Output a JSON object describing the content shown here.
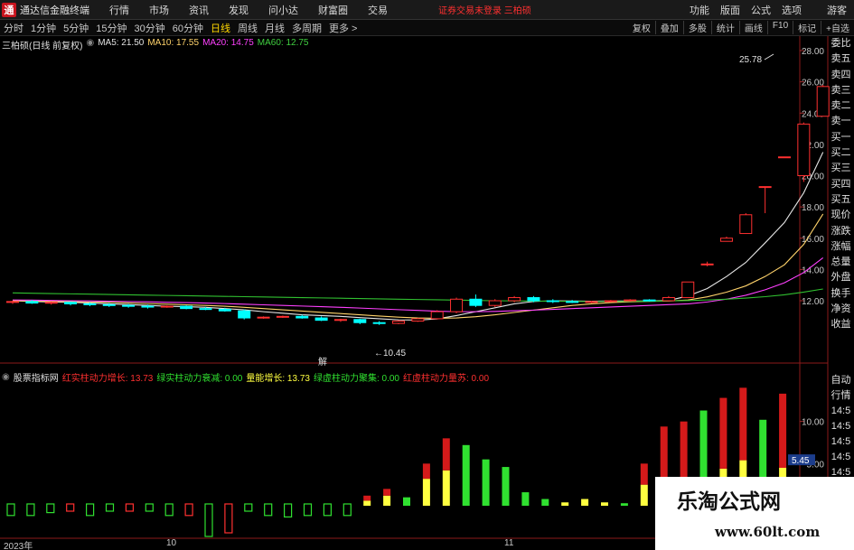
{
  "app": {
    "title": "通达信金融终端",
    "logo": "通",
    "menu": [
      "行情",
      "市场",
      "资讯",
      "发现",
      "问小达",
      "财富圈",
      "交易"
    ],
    "login_status": "证券交易未登录 三柏硕",
    "right_menu": [
      "功能",
      "版面",
      "公式",
      "选项"
    ],
    "guest": "游客"
  },
  "periods": {
    "items": [
      "分时",
      "1分钟",
      "5分钟",
      "15分钟",
      "30分钟",
      "60分钟",
      "日线",
      "周线",
      "月线",
      "多周期",
      "更多 >"
    ],
    "active": "日线"
  },
  "toolbar": [
    "复权",
    "叠加",
    "多股",
    "统计",
    "画线",
    "F10",
    "标记",
    "+自选"
  ],
  "stock": {
    "name": "三柏硕",
    "mode": "(日线 前复权)"
  },
  "ma": [
    {
      "label": "MA5: 21.50",
      "color": "#e0e0e0"
    },
    {
      "label": "MA10: 17.55",
      "color": "#ffd36b"
    },
    {
      "label": "MA20: 14.75",
      "color": "#ff40ff"
    },
    {
      "label": "MA60: 12.75",
      "color": "#40d040"
    }
  ],
  "right_panel": [
    "委比",
    "卖五",
    "卖四",
    "卖三",
    "卖二",
    "卖一",
    "买一",
    "买二",
    "买三",
    "买四",
    "买五",
    "现价",
    "涨跌",
    "涨幅",
    "总量",
    "外盘",
    "换手",
    "净资",
    "收益"
  ],
  "right_panel2": [
    "自动",
    "行情",
    "14:5",
    "14:5",
    "14:5",
    "14:5",
    "14:5",
    "14:5",
    "14:5",
    "14:5",
    "14:5",
    "14:5"
  ],
  "indicator": {
    "name": "股票指标网",
    "items": [
      {
        "label": "红实柱动力增长: 13.73",
        "color": "#ff3030"
      },
      {
        "label": "绿实柱动力衰减: 0.00",
        "color": "#30e030"
      },
      {
        "label": "量能增长: 13.73",
        "color": "#ffff40"
      },
      {
        "label": "绿虚柱动力聚集: 0.00",
        "color": "#30e030"
      },
      {
        "label": "红虚柱动力量苏: 0.00",
        "color": "#ff3030"
      }
    ],
    "ylabels": [
      "10.00",
      "5.00"
    ],
    "current": "5.45"
  },
  "annotations": {
    "high": "25.78",
    "low": "10.45",
    "event_mark": "解"
  },
  "time_axis": {
    "labels": [
      "2023年",
      "10",
      "11"
    ]
  },
  "watermark": {
    "text": "乐淘公式网",
    "url": "www.60lt.com"
  },
  "colors": {
    "up": "#ff3030",
    "down": "#00ffff",
    "up_fill": "#000000"
  },
  "chart_data": {
    "type": "candlestick",
    "ylim": [
      10.45,
      27.9
    ],
    "yticks": [
      12,
      14,
      16,
      18,
      20,
      22,
      24,
      26,
      28
    ],
    "ytick_labels": [
      "12.00",
      "14.00",
      "16.00",
      "18.00",
      "20.00",
      "22.00",
      "24.00",
      "26.00",
      "28.00"
    ],
    "candles": [
      [
        11.9,
        12.0,
        11.8,
        11.95
      ],
      [
        11.95,
        12.05,
        11.8,
        11.85
      ],
      [
        11.85,
        11.95,
        11.75,
        11.9
      ],
      [
        11.9,
        11.95,
        11.7,
        11.8
      ],
      [
        11.8,
        11.9,
        11.65,
        11.75
      ],
      [
        11.75,
        11.85,
        11.6,
        11.7
      ],
      [
        11.7,
        11.8,
        11.55,
        11.65
      ],
      [
        11.65,
        11.75,
        11.5,
        11.6
      ],
      [
        11.6,
        11.7,
        11.55,
        11.65
      ],
      [
        11.65,
        11.7,
        11.45,
        11.5
      ],
      [
        11.5,
        11.6,
        11.4,
        11.45
      ],
      [
        11.45,
        11.55,
        11.3,
        11.35
      ],
      [
        11.35,
        11.45,
        10.8,
        10.9
      ],
      [
        10.9,
        11.0,
        10.85,
        10.95
      ],
      [
        10.95,
        11.05,
        10.9,
        11.0
      ],
      [
        11.0,
        11.1,
        10.85,
        10.9
      ],
      [
        10.9,
        11.0,
        10.7,
        10.75
      ],
      [
        10.75,
        10.85,
        10.65,
        10.8
      ],
      [
        10.8,
        10.85,
        10.5,
        10.6
      ],
      [
        10.6,
        10.7,
        10.45,
        10.55
      ],
      [
        10.55,
        10.75,
        10.5,
        10.7
      ],
      [
        10.7,
        10.9,
        10.65,
        10.85
      ],
      [
        10.85,
        11.4,
        10.8,
        11.3
      ],
      [
        11.3,
        12.2,
        11.2,
        12.1
      ],
      [
        12.1,
        12.4,
        11.6,
        11.7
      ],
      [
        11.7,
        12.1,
        11.6,
        12.0
      ],
      [
        12.0,
        12.3,
        11.9,
        12.2
      ],
      [
        12.2,
        12.3,
        11.9,
        12.0
      ],
      [
        12.0,
        12.1,
        11.85,
        11.95
      ],
      [
        11.95,
        12.05,
        11.85,
        11.9
      ],
      [
        11.9,
        12.0,
        11.85,
        11.95
      ],
      [
        11.95,
        12.05,
        11.9,
        12.0
      ],
      [
        12.0,
        12.1,
        11.95,
        12.05
      ],
      [
        12.05,
        12.1,
        11.95,
        12.0
      ],
      [
        12.0,
        12.3,
        11.95,
        12.2
      ],
      [
        12.2,
        13.2,
        12.2,
        13.2
      ],
      [
        14.3,
        14.5,
        14.2,
        14.35
      ],
      [
        15.8,
        16.1,
        15.8,
        16.0
      ],
      [
        16.3,
        17.6,
        16.3,
        17.5
      ],
      [
        19.3,
        19.3,
        17.6,
        19.3
      ],
      [
        21.2,
        21.2,
        21.2,
        21.2
      ],
      [
        20.0,
        23.4,
        19.6,
        23.3
      ],
      [
        23.8,
        25.8,
        23.8,
        25.7
      ]
    ],
    "ma_lines": [
      {
        "name": "MA5",
        "color": "#e6e6e6",
        "values": [
          12.0,
          11.95,
          11.92,
          11.9,
          11.85,
          11.8,
          11.75,
          11.7,
          11.65,
          11.62,
          11.58,
          11.5,
          11.42,
          11.3,
          11.2,
          11.1,
          11.05,
          11.0,
          10.92,
          10.85,
          10.78,
          10.76,
          10.84,
          11.05,
          11.3,
          11.55,
          11.8,
          11.95,
          12.0,
          11.98,
          11.97,
          11.98,
          11.98,
          11.98,
          12.02,
          12.3,
          12.78,
          13.55,
          14.45,
          15.7,
          17.0,
          18.9,
          21.5
        ]
      },
      {
        "name": "MA10",
        "color": "#ffd36b",
        "values": [
          12.0,
          11.98,
          11.96,
          11.94,
          11.92,
          11.9,
          11.86,
          11.82,
          11.78,
          11.74,
          11.7,
          11.65,
          11.58,
          11.5,
          11.42,
          11.34,
          11.26,
          11.18,
          11.1,
          11.02,
          10.95,
          10.9,
          10.88,
          10.9,
          10.98,
          11.1,
          11.25,
          11.4,
          11.55,
          11.7,
          11.8,
          11.88,
          11.93,
          11.96,
          11.98,
          12.05,
          12.25,
          12.55,
          12.95,
          13.55,
          14.3,
          15.6,
          17.55
        ]
      },
      {
        "name": "MA20",
        "color": "#ff40ff",
        "values": [
          12.05,
          12.04,
          12.02,
          12.0,
          11.99,
          11.97,
          11.95,
          11.93,
          11.9,
          11.88,
          11.85,
          11.82,
          11.78,
          11.74,
          11.7,
          11.66,
          11.62,
          11.58,
          11.53,
          11.48,
          11.43,
          11.38,
          11.33,
          11.3,
          11.3,
          11.32,
          11.36,
          11.4,
          11.45,
          11.5,
          11.55,
          11.6,
          11.65,
          11.7,
          11.75,
          11.8,
          11.92,
          12.1,
          12.35,
          12.7,
          13.15,
          13.8,
          14.75
        ]
      },
      {
        "name": "MA60",
        "color": "#30c030",
        "values": [
          12.5,
          12.48,
          12.46,
          12.44,
          12.42,
          12.4,
          12.38,
          12.36,
          12.34,
          12.32,
          12.3,
          12.28,
          12.26,
          12.24,
          12.22,
          12.2,
          12.18,
          12.16,
          12.14,
          12.12,
          12.1,
          12.08,
          12.06,
          12.04,
          12.02,
          12.0,
          11.99,
          11.98,
          11.97,
          11.96,
          11.95,
          11.95,
          11.96,
          11.97,
          11.99,
          12.01,
          12.05,
          12.1,
          12.17,
          12.26,
          12.38,
          12.55,
          12.75
        ]
      }
    ],
    "indicator_ylim": [
      0,
      15
    ],
    "indicator_bars": [
      [
        0,
        1.6,
        "g",
        0
      ],
      [
        0,
        1.6,
        "g",
        0
      ],
      [
        0,
        1.2,
        "g",
        0
      ],
      [
        0,
        0.7,
        "r",
        0
      ],
      [
        0,
        1.6,
        "g",
        0
      ],
      [
        0,
        0.5,
        "g",
        0
      ],
      [
        0,
        0.7,
        "r",
        0
      ],
      [
        0,
        0.4,
        "g",
        0
      ],
      [
        0,
        1.6,
        "g",
        0
      ],
      [
        0,
        1.6,
        "r",
        0
      ],
      [
        0,
        4.5,
        "g",
        0
      ],
      [
        0,
        4.0,
        "r",
        0
      ],
      [
        0,
        1.0,
        "g",
        0
      ],
      [
        0,
        1.6,
        "g",
        0
      ],
      [
        0,
        1.8,
        "g",
        0
      ],
      [
        0,
        1.6,
        "g",
        0
      ],
      [
        0,
        1.6,
        "g",
        0
      ],
      [
        0,
        1.6,
        "g",
        0
      ],
      [
        0.6,
        0.6,
        "y",
        0.6
      ],
      [
        1.2,
        0.8,
        "r",
        1.2
      ],
      [
        1.0,
        0.5,
        "g",
        1.0
      ],
      [
        3.2,
        1.8,
        "g",
        0
      ],
      [
        4.2,
        3.8,
        "r",
        4.2
      ],
      [
        7.2,
        0,
        "g",
        7.2
      ],
      [
        5.5,
        0,
        "g",
        5.5
      ],
      [
        4.6,
        0,
        "g",
        4.6
      ],
      [
        1.6,
        0,
        "g",
        1.6
      ],
      [
        0.8,
        0,
        "g",
        0.8
      ],
      [
        0.4,
        0,
        "y",
        0.4
      ],
      [
        0.8,
        0,
        "y",
        0.8
      ],
      [
        0.4,
        0,
        "y",
        0.4
      ],
      [
        0.3,
        0,
        "g",
        0.3
      ],
      [
        2.5,
        2.5,
        "r",
        2.5
      ],
      [
        2.4,
        7.0,
        "r",
        2.4
      ],
      [
        3.0,
        7.0,
        "r",
        3.0
      ],
      [
        11.3,
        0,
        "g",
        11.3
      ],
      [
        4.4,
        8.4,
        "r",
        4.4
      ],
      [
        5.4,
        8.6,
        "r",
        5.4
      ],
      [
        10.2,
        0,
        "g",
        10.2
      ],
      [
        4.5,
        8.8,
        "r",
        4.5
      ]
    ]
  }
}
